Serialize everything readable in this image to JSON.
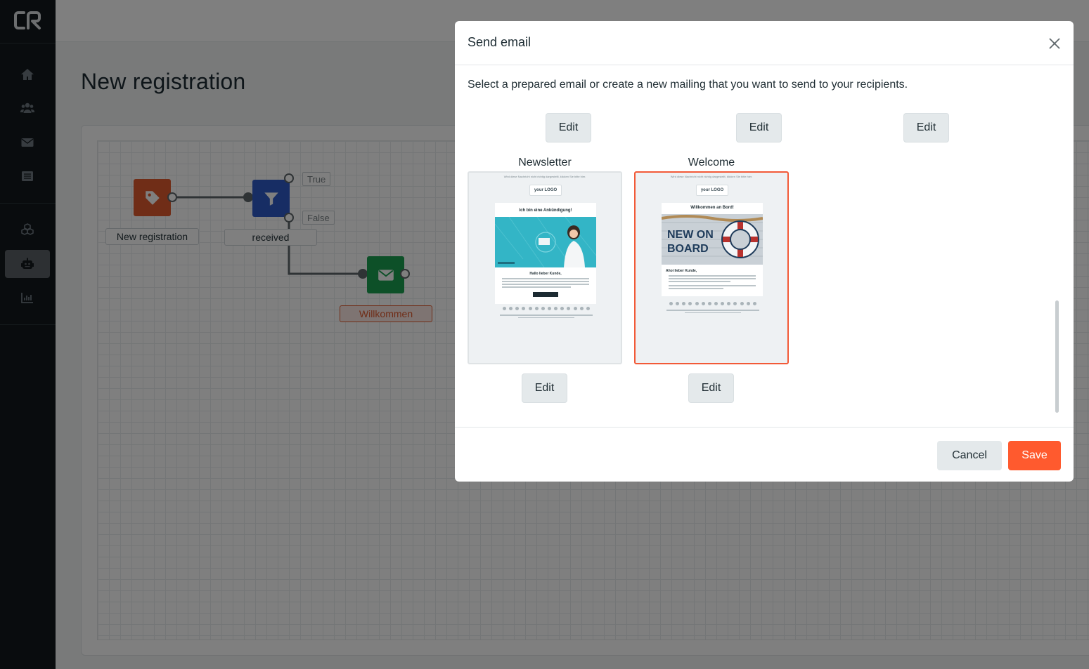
{
  "sidebar": {
    "logo": "CR",
    "items": [
      {
        "icon": "home-icon",
        "active": false
      },
      {
        "icon": "contacts-icon",
        "active": false
      },
      {
        "icon": "mail-icon",
        "active": false
      },
      {
        "icon": "list-icon",
        "active": false
      },
      {
        "icon": "cubes-icon",
        "active": false
      },
      {
        "icon": "robot-icon",
        "active": true
      },
      {
        "icon": "chart-icon",
        "active": false
      }
    ]
  },
  "page": {
    "title": "New registration"
  },
  "workflow": {
    "nodes": [
      {
        "type": "trigger",
        "icon": "tag-icon",
        "label": "New registration",
        "color": "#e05a2e"
      },
      {
        "type": "condition",
        "icon": "filter-icon",
        "label": "received",
        "color": "#2e5bc9"
      },
      {
        "type": "action",
        "icon": "mail-icon",
        "label": "Willkommen",
        "color": "#1aa050"
      }
    ],
    "port_true": "True",
    "port_false": "False"
  },
  "modal": {
    "title": "Send email",
    "intro": "Select a prepared email or create a new mailing that you want to send to your recipients.",
    "edit_label": "Edit",
    "templates": [
      {
        "name": "Newsletter",
        "selected": false,
        "preview": {
          "top_line": "Wird diese Nachricht nicht richtig dargestellt, klicken Sie bitte hier.",
          "logo": "your LOGO",
          "headline": "Ich bin eine Ankündigung!",
          "greeting": "Hallo lieber Kunde,",
          "image_accent": "#2fb3c5"
        }
      },
      {
        "name": "Welcome",
        "selected": true,
        "preview": {
          "top_line": "Wird diese Nachricht nicht richtig dargestellt, klicken Sie bitte hier.",
          "logo": "your LOGO",
          "headline": "Willkommen an Bord!",
          "image_text": "NEW ON BOARD",
          "greeting": "Ahoi lieber Kunde,"
        }
      }
    ],
    "cancel_label": "Cancel",
    "save_label": "Save"
  },
  "colors": {
    "accent": "#ff5a2e",
    "sidebar_bg": "#12191d"
  }
}
